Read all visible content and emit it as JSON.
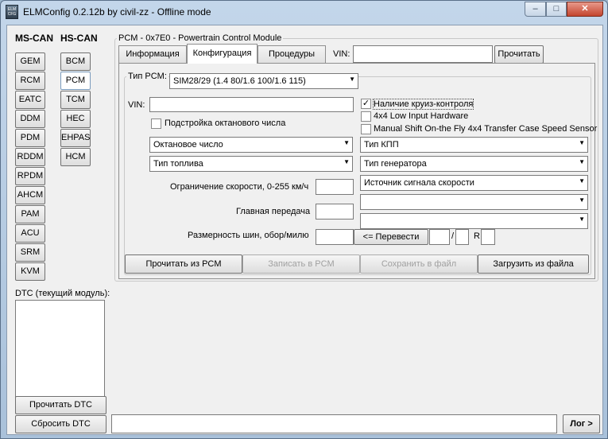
{
  "window": {
    "title": "ELMConfig 0.2.12b by civil-zz - Offline mode",
    "min_glyph": "–",
    "max_glyph": "□",
    "close_glyph": "✕"
  },
  "modules": {
    "ms_can_label": "MS-CAN",
    "hs_can_label": "HS-CAN",
    "ms_can": [
      "GEM",
      "RCM",
      "EATC",
      "DDM",
      "PDM",
      "RDDM",
      "RPDM",
      "AHCM",
      "PAM",
      "ACU",
      "SRM",
      "KVM"
    ],
    "hs_can": [
      "BCM",
      "PCM",
      "TCM",
      "HEC",
      "EHPAS",
      "HCM"
    ],
    "selected": "PCM"
  },
  "dtc": {
    "label": "DTC (текущий модуль):",
    "read_button": "Прочитать DTC",
    "reset_button": "Сбросить DTC"
  },
  "pcm": {
    "group_title": "PCM - 0x7E0 - Powertrain Control Module",
    "tabs": [
      "Информация",
      "Конфигурация",
      "Процедуры"
    ],
    "active_tab": "Конфигурация",
    "vin_label": "VIN:",
    "vin_value": "",
    "read_button": "Прочитать"
  },
  "config": {
    "type_label": "Тип PCM:",
    "type_value": "SIM28/29 (1.4 80/1.6 100/1.6 115)",
    "vin_label": "VIN:",
    "vin_value": "",
    "octane_adjust_label": "Подстройка октанового числа",
    "octane_adjust_checked": false,
    "cruise_label": "Наличие круиз-контроля",
    "cruise_checked": true,
    "low_input_label": "4x4 Low Input Hardware",
    "low_input_checked": false,
    "manual_shift_label": "Manual Shift On-the Fly 4x4 Transfer Case Speed Sensor",
    "manual_shift_checked": false,
    "octane_combo": "Октановое число",
    "fuel_combo": "Тип топлива",
    "gearbox_combo": "Тип КПП",
    "generator_combo": "Тип генератора",
    "speed_source_combo": "Источник сигнала скорости",
    "empty_combo_1": "",
    "empty_combo_2": "",
    "speed_limit_label": "Ограничение скорости, 0-255 км/ч",
    "speed_limit_value": "",
    "final_drive_label": "Главная передача",
    "final_drive_value": "",
    "tire_label": "Размерность шин, обор/милю",
    "tire_value": "",
    "convert_button": "<= Перевести",
    "tire_width": "",
    "slash": "/",
    "tire_profile": "",
    "r_label": "R",
    "tire_radius": "",
    "read_pcm_button": "Прочитать из PCM",
    "write_pcm_button": "Записать в PCM",
    "save_file_button": "Сохранить в файл",
    "load_file_button": "Загрузить из файла"
  },
  "status": {
    "log_value": "",
    "log_button": "Лог >"
  }
}
